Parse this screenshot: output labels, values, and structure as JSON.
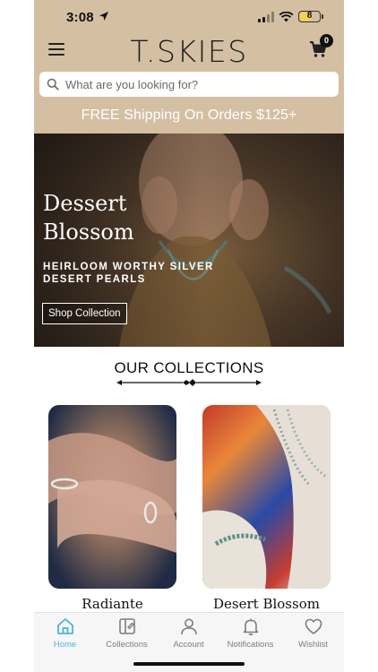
{
  "status_bar": {
    "time": "3:08",
    "battery": "8"
  },
  "header": {
    "brand": "T.SKIES",
    "cart_count": "0"
  },
  "search": {
    "placeholder": "What are you looking for?"
  },
  "promo": {
    "text": "FREE Shipping On Orders $125+"
  },
  "hero": {
    "title_line1": "Dessert",
    "title_line2": "Blossom",
    "subtitle_line1": "HEIRLOOM WORTHY SILVER",
    "subtitle_line2": "DESERT PEARLS",
    "button": "Shop Collection"
  },
  "collections": {
    "heading": "OUR COLLECTIONS",
    "items": [
      {
        "label": "Radiante"
      },
      {
        "label": "Desert Blossom"
      }
    ]
  },
  "tabs": [
    {
      "label": "Home",
      "icon": "home-icon",
      "active": true
    },
    {
      "label": "Collections",
      "icon": "collections-icon",
      "active": false
    },
    {
      "label": "Account",
      "icon": "account-icon",
      "active": false
    },
    {
      "label": "Notifications",
      "icon": "bell-icon",
      "active": false
    },
    {
      "label": "Wishlist",
      "icon": "heart-icon",
      "active": false
    }
  ],
  "colors": {
    "header_bg": "#d4bfa3",
    "accent": "#4fb3d9",
    "tab_inactive": "#7d7d7d"
  }
}
